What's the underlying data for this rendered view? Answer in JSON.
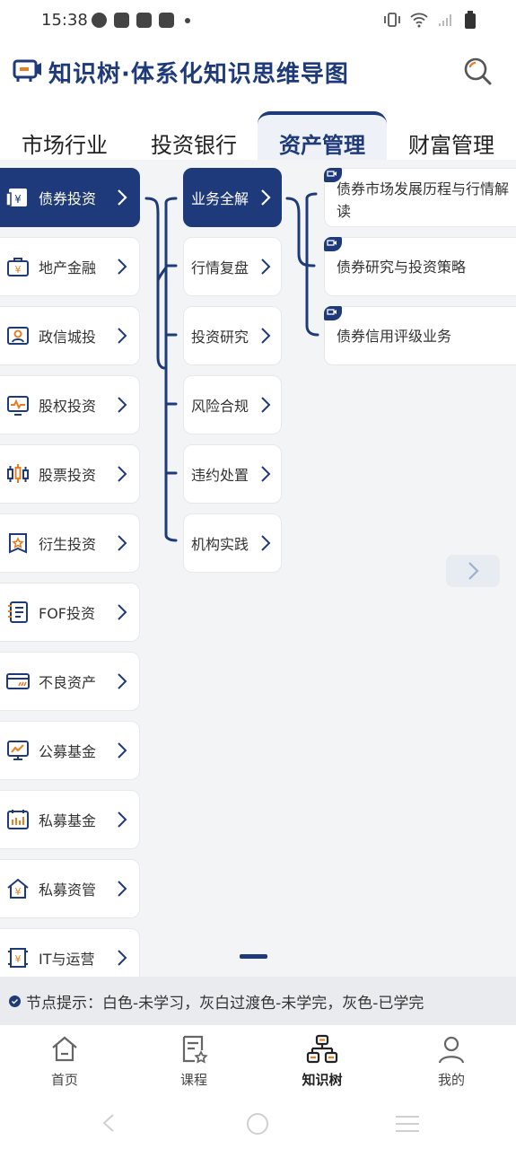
{
  "status_bar": {
    "time": "15:38"
  },
  "header": {
    "title": "知识树·体系化知识思维导图"
  },
  "tabs": [
    {
      "label": "市场行业"
    },
    {
      "label": "投资银行"
    },
    {
      "label": "资产管理",
      "active": true
    },
    {
      "label": "财富管理"
    }
  ],
  "level1": [
    {
      "label": "债券投资",
      "icon": "yen-card-icon",
      "active": true
    },
    {
      "label": "地产金融",
      "icon": "briefcase-yen-icon"
    },
    {
      "label": "政信城投",
      "icon": "person-card-icon"
    },
    {
      "label": "股权投资",
      "icon": "pulse-monitor-icon"
    },
    {
      "label": "股票投资",
      "icon": "candlestick-icon"
    },
    {
      "label": "衍生投资",
      "icon": "badge-star-icon"
    },
    {
      "label": "FOF投资",
      "icon": "document-list-icon"
    },
    {
      "label": "不良资产",
      "icon": "card-slash-icon"
    },
    {
      "label": "公募基金",
      "icon": "chart-monitor-icon"
    },
    {
      "label": "私募基金",
      "icon": "bar-calendar-icon"
    },
    {
      "label": "私募资管",
      "icon": "house-yen-icon"
    },
    {
      "label": "IT与运营",
      "icon": "yen-scroll-icon"
    }
  ],
  "level2": [
    {
      "label": "业务全解",
      "active": true
    },
    {
      "label": "行情复盘"
    },
    {
      "label": "投资研究"
    },
    {
      "label": "风险合规"
    },
    {
      "label": "违约处置"
    },
    {
      "label": "机构实践"
    }
  ],
  "level3": [
    {
      "label": "债券市场发展历程与行情解读"
    },
    {
      "label": "债券研究与投资策略"
    },
    {
      "label": "债券信用评级业务"
    }
  ],
  "hint": {
    "text": "节点提示：白色-未学习，灰白过渡色-未学完，灰色-已学完"
  },
  "bottom_nav": [
    {
      "label": "首页",
      "icon": "home-icon"
    },
    {
      "label": "课程",
      "icon": "course-icon"
    },
    {
      "label": "知识树",
      "icon": "tree-icon",
      "active": true
    },
    {
      "label": "我的",
      "icon": "profile-icon"
    }
  ],
  "colors": {
    "primary": "#1f3a7a",
    "background": "#f3f4f6"
  }
}
